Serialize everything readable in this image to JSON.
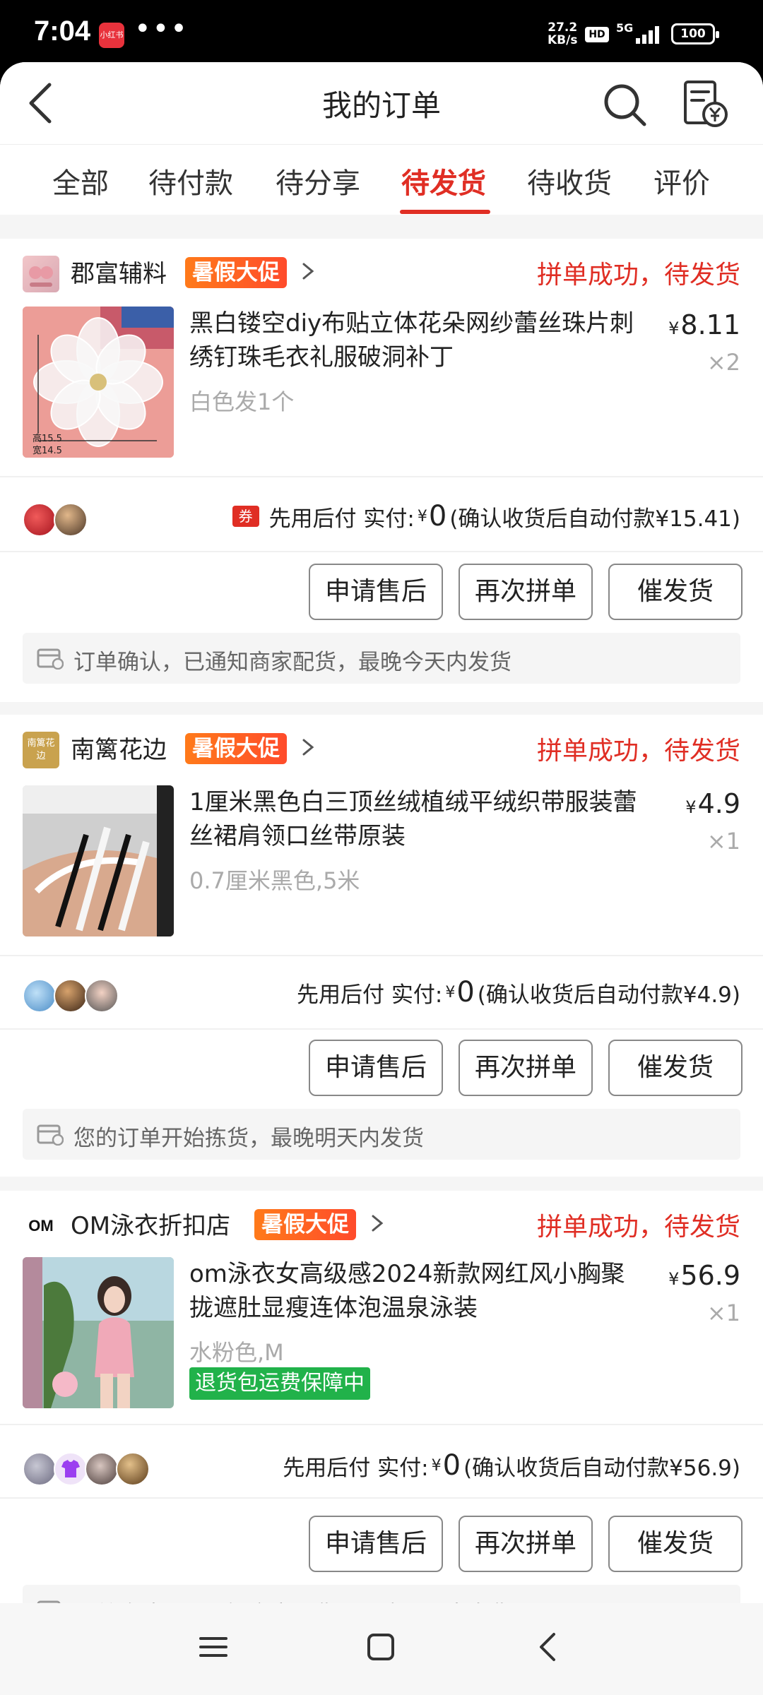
{
  "status_bar": {
    "time": "7:04",
    "app_badge": "小红书",
    "dots": "•••",
    "speed_value": "27.2",
    "speed_unit": "KB/s",
    "hd": "HD",
    "network": "5G",
    "battery": "100"
  },
  "header": {
    "title": "我的订单"
  },
  "tabs": [
    {
      "label": "全部"
    },
    {
      "label": "待付款"
    },
    {
      "label": "待分享"
    },
    {
      "label": "待发货",
      "active": true
    },
    {
      "label": "待收货"
    },
    {
      "label": "评价"
    }
  ],
  "orders": [
    {
      "shop": "郡富辅料",
      "promo": "暑假大促",
      "status": "拼单成功，待发货",
      "title": "黑白镂空diy布贴立体花朵网纱蕾丝珠片刺绣钉珠毛衣礼服破洞补丁",
      "currency": "¥",
      "price": "8.11",
      "qty": "×2",
      "spec": "白色发1个",
      "thumb_labels": [
        "高15.5",
        "宽14.5"
      ],
      "pay_prefix": "先用后付  实付:",
      "pay_currency": "¥",
      "pay_amount": "0",
      "pay_note": "(确认收货后自动付款¥15.41)",
      "coupon": "券",
      "buttons": [
        "申请售后",
        "再次拼单",
        "催发货"
      ],
      "notice": "订单确认，已通知商家配货，最晚今天内发货"
    },
    {
      "shop": "南篱花边",
      "logo_text": "南篱花边",
      "promo": "暑假大促",
      "status": "拼单成功，待发货",
      "title": "1厘米黑色白三顶丝绒植绒平绒织带服装蕾丝裙肩领口丝带原装",
      "currency": "¥",
      "price": "4.9",
      "qty": "×1",
      "spec": "0.7厘米黑色,5米",
      "pay_prefix": "先用后付  实付:",
      "pay_currency": "¥",
      "pay_amount": "0",
      "pay_note": "(确认收货后自动付款¥4.9)",
      "buttons": [
        "申请售后",
        "再次拼单",
        "催发货"
      ],
      "notice": "您的订单开始拣货，最晚明天内发货"
    },
    {
      "shop": "OM泳衣折扣店",
      "logo_text": "OM",
      "promo": "暑假大促",
      "status": "拼单成功，待发货",
      "title": "om泳衣女高级感2024新款网红风小胸聚拢遮肚显瘦连体泡温泉泳装",
      "currency": "¥",
      "price": "56.9",
      "qty": "×1",
      "spec": "水粉色,M",
      "guarantee": "退货包运费保障中",
      "pay_prefix": "先用后付  实付:",
      "pay_currency": "¥",
      "pay_amount": "0",
      "pay_note": "(确认收货后自动付款¥56.9)",
      "buttons": [
        "申请售后",
        "再次拼单",
        "催发货"
      ],
      "notice": "订单确认，已通知商家配货，最晚明天内发货"
    }
  ],
  "colors": {
    "accent": "#e02e24",
    "promo": "#ff5a24",
    "guarantee": "#21b24a"
  }
}
